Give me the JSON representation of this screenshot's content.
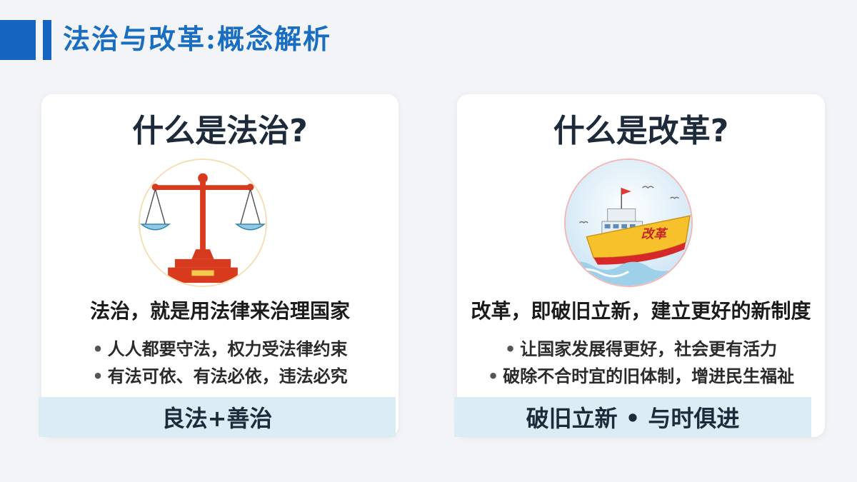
{
  "header": {
    "title": "法治与改革:概念解析"
  },
  "cards": [
    {
      "heading": "什么是法治?",
      "emblem_icon": "scales-of-justice-icon",
      "definition": "法治，就是用法律来治理国家",
      "bullets": [
        "人人都要守法，权力受法律约束",
        "有法可依、有法必依，违法必究"
      ],
      "footer": "良法+善治"
    },
    {
      "heading": "什么是改革?",
      "emblem_icon": "reform-ship-icon",
      "emblem_text": "改革",
      "definition": "改革，即破旧立新，建立更好的新制度",
      "bullets": [
        "让国家发展得更好，社会更有活力",
        "破除不合时宜的旧体制，增进民生福祉"
      ],
      "footer": "破旧立新 • 与时俱进"
    }
  ],
  "colors": {
    "accent": "#1565c0",
    "title": "#1a6ec2",
    "band": "#dcecf4"
  },
  "bullet_marker": "•"
}
